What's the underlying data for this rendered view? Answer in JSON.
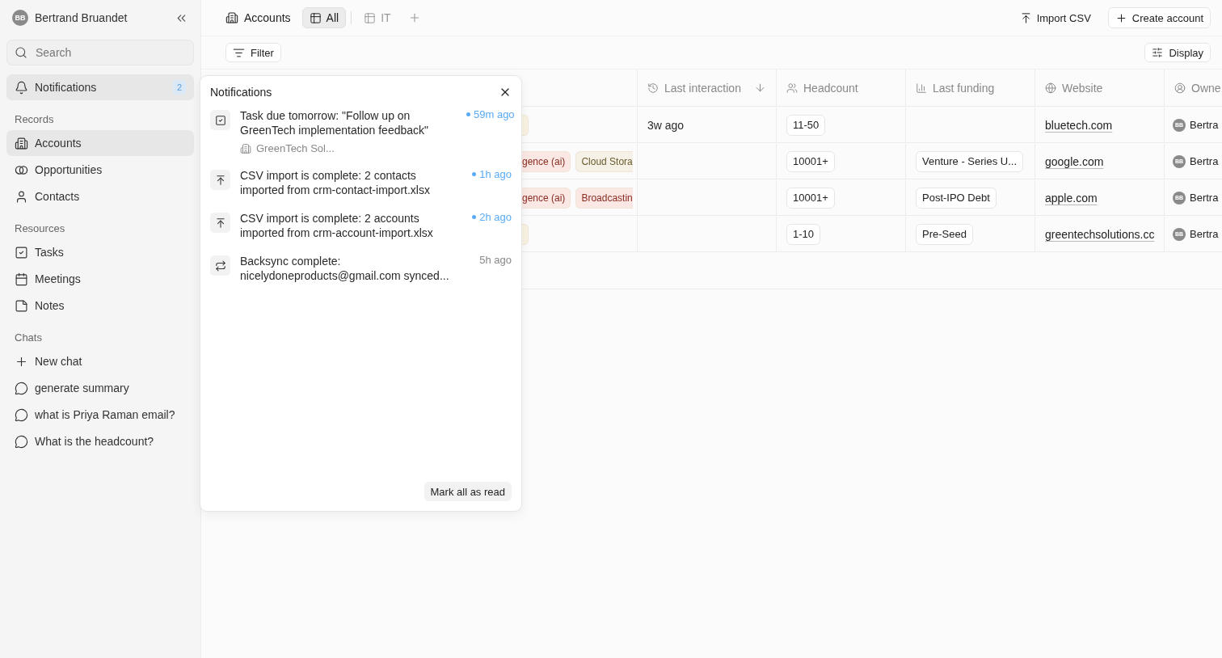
{
  "user": {
    "initials": "BB",
    "name": "Bertrand Bruandet"
  },
  "search": {
    "placeholder": "Search"
  },
  "notifications_link": {
    "label": "Notifications",
    "badge": "2",
    "selected": true
  },
  "sidebar_sections": [
    {
      "title": "Records",
      "items": [
        {
          "kind": "building",
          "label": "Accounts",
          "selected": true
        },
        {
          "kind": "rings",
          "label": "Opportunities",
          "selected": false
        },
        {
          "kind": "person",
          "label": "Contacts",
          "selected": false
        }
      ]
    },
    {
      "title": "Resources",
      "items": [
        {
          "kind": "task",
          "label": "Tasks",
          "selected": false
        },
        {
          "kind": "calendar",
          "label": "Meetings",
          "selected": false
        },
        {
          "kind": "note",
          "label": "Notes",
          "selected": false
        }
      ]
    },
    {
      "title": "Chats",
      "items": [
        {
          "kind": "plus",
          "label": "New chat",
          "selected": false
        },
        {
          "kind": "chat",
          "label": "generate summary",
          "selected": false
        },
        {
          "kind": "chat",
          "label": "what is Priya Raman email?",
          "selected": false
        },
        {
          "kind": "chat",
          "label": "What is the headcount?",
          "selected": false
        }
      ]
    }
  ],
  "header": {
    "title": "Accounts",
    "views": [
      {
        "label": "All",
        "selected": true
      },
      {
        "label": "IT",
        "selected": false
      }
    ],
    "actions": [
      {
        "kind": "import",
        "label": "Import CSV"
      },
      {
        "kind": "create",
        "label": "Create account"
      }
    ]
  },
  "toolbar": {
    "filter": "Filter",
    "display": "Display"
  },
  "table": {
    "columns": [
      {
        "kind": "tags"
      },
      {
        "kind": "interaction",
        "label": "Last interaction",
        "sorted": true
      },
      {
        "kind": "headcount",
        "label": "Headcount"
      },
      {
        "kind": "funding",
        "label": "Last funding"
      },
      {
        "kind": "website",
        "label": "Website"
      },
      {
        "kind": "owner",
        "label": "Owne"
      }
    ],
    "rows": [
      {
        "tags": [
          {
            "color": "#fbf3e2"
          }
        ],
        "last_interaction": "3w ago",
        "headcount": "11-50",
        "website": "bluetech.com",
        "owner": {
          "initials": "BB",
          "name": "Bertra"
        }
      },
      {
        "tags": [
          {
            "text": "gence (ai)",
            "color": "#fbe7e4"
          },
          {
            "text": "Cloud Stora",
            "color": "#f5f1e6"
          }
        ],
        "headcount": "10001+",
        "last_funding": "Venture - Series U...",
        "website": "google.com",
        "owner": {
          "initials": "BB",
          "name": "Bertra"
        }
      },
      {
        "tags": [
          {
            "text": "gence (ai)",
            "color": "#fbe7e4"
          },
          {
            "text": "Broadcastin",
            "color": "#fbe7e4"
          }
        ],
        "headcount": "10001+",
        "last_funding": "Post-IPO Debt",
        "website": "apple.com",
        "owner": {
          "initials": "BB",
          "name": "Bertra"
        }
      },
      {
        "tags": [
          {
            "color": "#fbf3e2"
          }
        ],
        "headcount": "1-10",
        "last_funding": "Pre-Seed",
        "website": "greentechsolutions.cc",
        "owner": {
          "initials": "BB",
          "name": "Bertra"
        }
      }
    ]
  },
  "notifications_panel": {
    "title": "Notifications",
    "items": [
      {
        "kind": "task",
        "text": "Task due tomorrow: \"Follow up on GreenTech implementation feedback\"",
        "link": "GreenTech Sol...",
        "time": "59m ago",
        "unread": true
      },
      {
        "kind": "import",
        "text": "CSV import is complete: 2 contacts imported from crm-contact-import.xlsx",
        "time": "1h ago",
        "unread": true
      },
      {
        "kind": "import",
        "text": "CSV import is complete: 2 accounts imported from crm-account-import.xlsx",
        "time": "2h ago",
        "unread": true
      },
      {
        "kind": "sync",
        "text": "Backsync complete: nicelydoneproducts@gmail.com synced...",
        "time": "5h ago",
        "unread": false
      }
    ],
    "footer_action": "Mark all as read"
  }
}
